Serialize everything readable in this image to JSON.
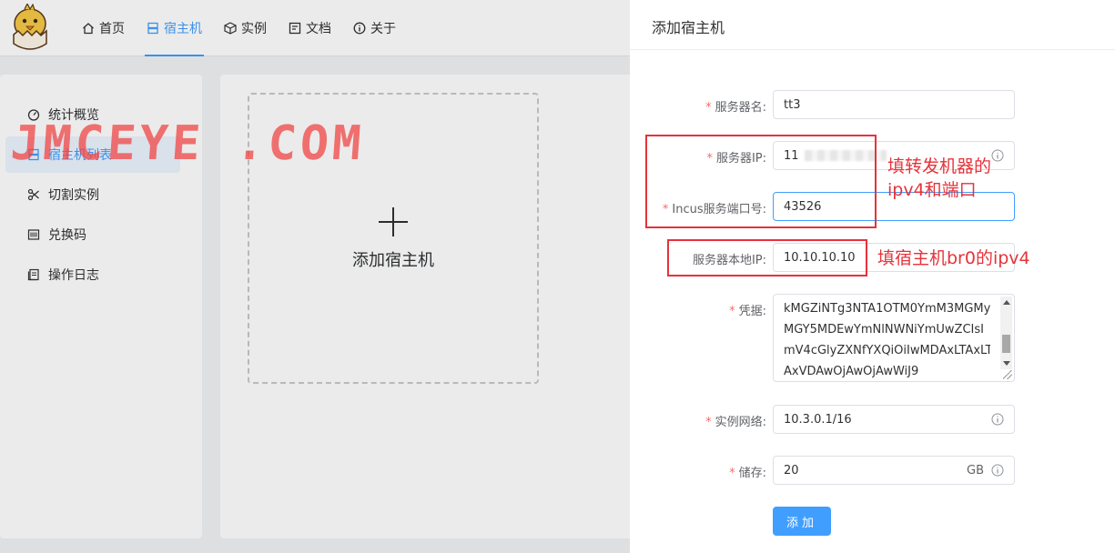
{
  "header": {
    "nav": [
      {
        "label": "首页",
        "icon": "home-icon"
      },
      {
        "label": "宿主机",
        "icon": "server-icon",
        "active": true
      },
      {
        "label": "实例",
        "icon": "box-icon"
      },
      {
        "label": "文档",
        "icon": "document-icon"
      },
      {
        "label": "关于",
        "icon": "info-icon"
      }
    ]
  },
  "sidebar": {
    "items": [
      {
        "label": "统计概览",
        "icon": "dashboard-icon"
      },
      {
        "label": "宿主机列表",
        "icon": "server-icon",
        "active": true
      },
      {
        "label": "切割实例",
        "icon": "scissors-icon"
      },
      {
        "label": "兑换码",
        "icon": "barcode-icon"
      },
      {
        "label": "操作日志",
        "icon": "log-icon"
      }
    ]
  },
  "main": {
    "add_host_label": "添加宿主机"
  },
  "watermark": "JMCEYE .COM",
  "drawer": {
    "title": "添加宿主机",
    "fields": {
      "server_name": {
        "label": "服务器名:",
        "value": "tt3",
        "required": true
      },
      "server_ip": {
        "label": "服务器IP:",
        "value": "11",
        "required": true
      },
      "incus_port": {
        "label": "Incus服务端口号:",
        "value": "43526",
        "required": true
      },
      "local_ip": {
        "label": "服务器本地IP:",
        "value": "10.10.10.10",
        "required": false
      },
      "credential": {
        "label": "凭据:",
        "required": true,
        "lines": [
          "kMGZiNTg3NTA1OTM0YmM3MGMy",
          "MGY5MDEwYmNlNWNiYmUwZCIsI",
          "mV4cGlyZXNfYXQiOiIwMDAxLTAxLT",
          "AxVDAwOjAwOjAwWiJ9"
        ]
      },
      "network": {
        "label": "实例网络:",
        "value": "10.3.0.1/16",
        "required": true
      },
      "storage": {
        "label": "储存:",
        "value": "20",
        "unit": "GB",
        "required": true
      }
    },
    "submit_label": "添加"
  },
  "annotations": {
    "forward_note_line1": "填转发机器的",
    "forward_note_line2": "ipv4和端口",
    "host_note": "填宿主机br0的ipv4"
  },
  "colors": {
    "primary": "#409eff",
    "annotation_red": "#e5333a",
    "required_star": "#f56c6c"
  }
}
